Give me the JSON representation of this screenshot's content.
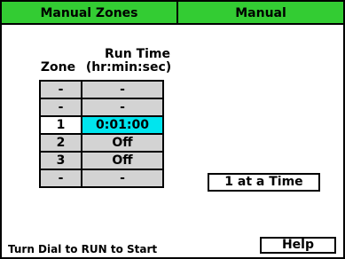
{
  "header": {
    "left_title": "Manual Zones",
    "right_title": "Manual"
  },
  "columns": {
    "zone": "Zone",
    "run_time_1": "Run Time",
    "run_time_2": "(hr:min:sec)"
  },
  "rows": [
    {
      "zone": "-",
      "time": "-"
    },
    {
      "zone": "-",
      "time": "-"
    },
    {
      "zone": "1",
      "time": "0:01:00",
      "selected": true
    },
    {
      "zone": "2",
      "time": "Off"
    },
    {
      "zone": "3",
      "time": "Off"
    },
    {
      "zone": "-",
      "time": "-"
    }
  ],
  "mode_button": "1 at a Time",
  "help_button": "Help",
  "footer": "Turn Dial to RUN to Start",
  "colors": {
    "header": "#33cc33",
    "selected_time": "#00e5ee",
    "cell": "#d3d3d3"
  }
}
